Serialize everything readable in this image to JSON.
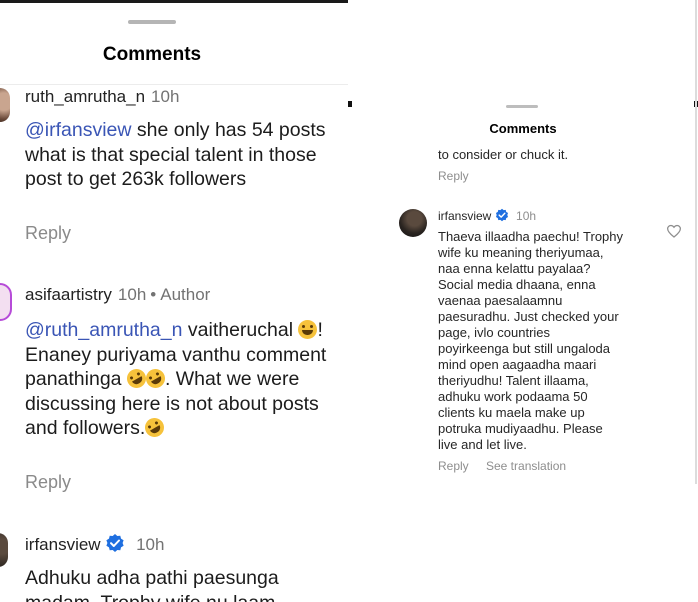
{
  "left": {
    "title": "Comments",
    "comments": [
      {
        "username": "ruth_amrutha_n",
        "time": "10h",
        "mention": "@irfansview",
        "text_after_mention": " she only has 54 posts what is that special talent in those post to get 263k followers",
        "reply_label": "Reply"
      },
      {
        "username": "asifaartistry",
        "time": "10h",
        "separator": "•",
        "author_label": "Author",
        "mention": "@ruth_amrutha_n",
        "text_part1": " vaitheruchal ",
        "text_part2": "! Enaney puriyama vanthu comment panathinga ",
        "text_part3": ". What we were discussing here is not about posts and followers.",
        "reply_label": "Reply"
      },
      {
        "username": "irfansview",
        "time": "10h",
        "text": "Adhuku adha pathi paesunga madam. Trophy wife nu laam"
      }
    ]
  },
  "right": {
    "title": "Comments",
    "prev_text": "to consider or chuck it.",
    "prev_reply_label": "Reply",
    "comment": {
      "username": "irfansview",
      "time": "10h",
      "lines": [
        "Thaeva illaadha paechu! Trophy",
        "wife ku meaning theriyumaa,",
        "naa enna kelattu payalaa?",
        "Social media dhaana, enna",
        "vaenaa paesalaamnu",
        "paesuradhu. Just checked your",
        "page, ivlo countries",
        "poyirkeenga but still ungaloda",
        "mind open aagaadha maari",
        "theriyudhu! Talent illaama,",
        "adhuku work podaama 50",
        "clients ku maela make up",
        "potruka mudiyaadhu. Please",
        "live and let live."
      ],
      "reply_label": "Reply",
      "see_translation_label": "See translation"
    }
  },
  "colors": {
    "mention": "#3a55b5",
    "verified": "#1f6fe0",
    "muted": "#8e8e8e"
  },
  "icons": [
    "verified-badge-icon",
    "heart-outline-icon",
    "laughing-emoji-icon",
    "rofl-emoji-icon"
  ]
}
